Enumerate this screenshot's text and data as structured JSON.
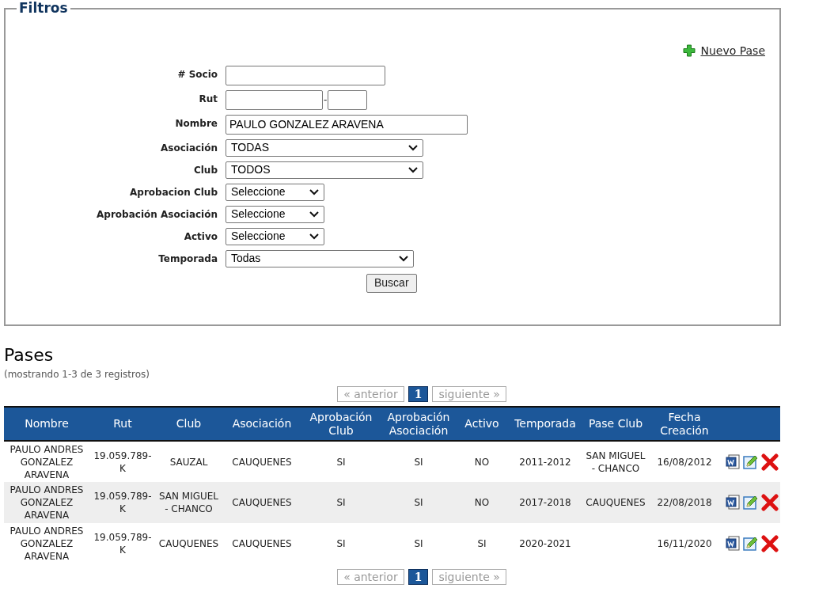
{
  "filters": {
    "legend": "Filtros",
    "new_link": "Nuevo Pase",
    "fields": [
      {
        "kind": "text",
        "label": "# Socio"
      },
      {
        "kind": "rut",
        "label": "Rut",
        "separator": "-"
      },
      {
        "kind": "text",
        "label": "Nombre",
        "value": "PAULO GONZALEZ ARAVENA"
      },
      {
        "kind": "select",
        "label": "Asociación",
        "value": "TODAS"
      },
      {
        "kind": "select",
        "label": "Club",
        "value": "TODOS"
      },
      {
        "kind": "select",
        "label": "Aprobacion Club",
        "value": "Seleccione"
      },
      {
        "kind": "select",
        "label": "Aprobación Asociación",
        "value": "Seleccione"
      },
      {
        "kind": "select",
        "label": "Activo",
        "value": "Seleccione"
      },
      {
        "kind": "select",
        "label": "Temporada",
        "value": "Todas"
      }
    ],
    "button": "Buscar"
  },
  "results": {
    "title": "Pases",
    "count": "(mostrando 1-3 de 3 registros)",
    "pagination_top": {
      "prev": "« anterior",
      "page": "1",
      "next": "siguiente »"
    },
    "columns": [
      "Nombre",
      "Rut",
      "Club",
      "Asociación",
      "Aprobación Club",
      "Aprobación Asociación",
      "Activo",
      "Temporada",
      "Pase Club",
      "Fecha Creación"
    ],
    "rows": [
      {
        "cells": [
          "PAULO ANDRES GONZALEZ ARAVENA",
          "19.059.789-K",
          "SAUZAL",
          "CAUQUENES",
          "SI",
          "SI",
          "NO",
          "2011-2012",
          "SAN MIGUEL - CHANCO",
          "16/08/2012"
        ]
      },
      {
        "cells": [
          "PAULO ANDRES GONZALEZ ARAVENA",
          "19.059.789-K",
          "SAN MIGUEL - CHANCO",
          "CAUQUENES",
          "SI",
          "SI",
          "NO",
          "2017-2018",
          "CAUQUENES",
          "22/08/2018"
        ]
      },
      {
        "cells": [
          "PAULO ANDRES GONZALEZ ARAVENA",
          "19.059.789-K",
          "CAUQUENES",
          "CAUQUENES",
          "SI",
          "SI",
          "SI",
          "2020-2021",
          null,
          "16/11/2020"
        ]
      }
    ],
    "pagination_bottom": {
      "prev": "« anterior",
      "page": "1",
      "next": "siguiente »"
    }
  }
}
